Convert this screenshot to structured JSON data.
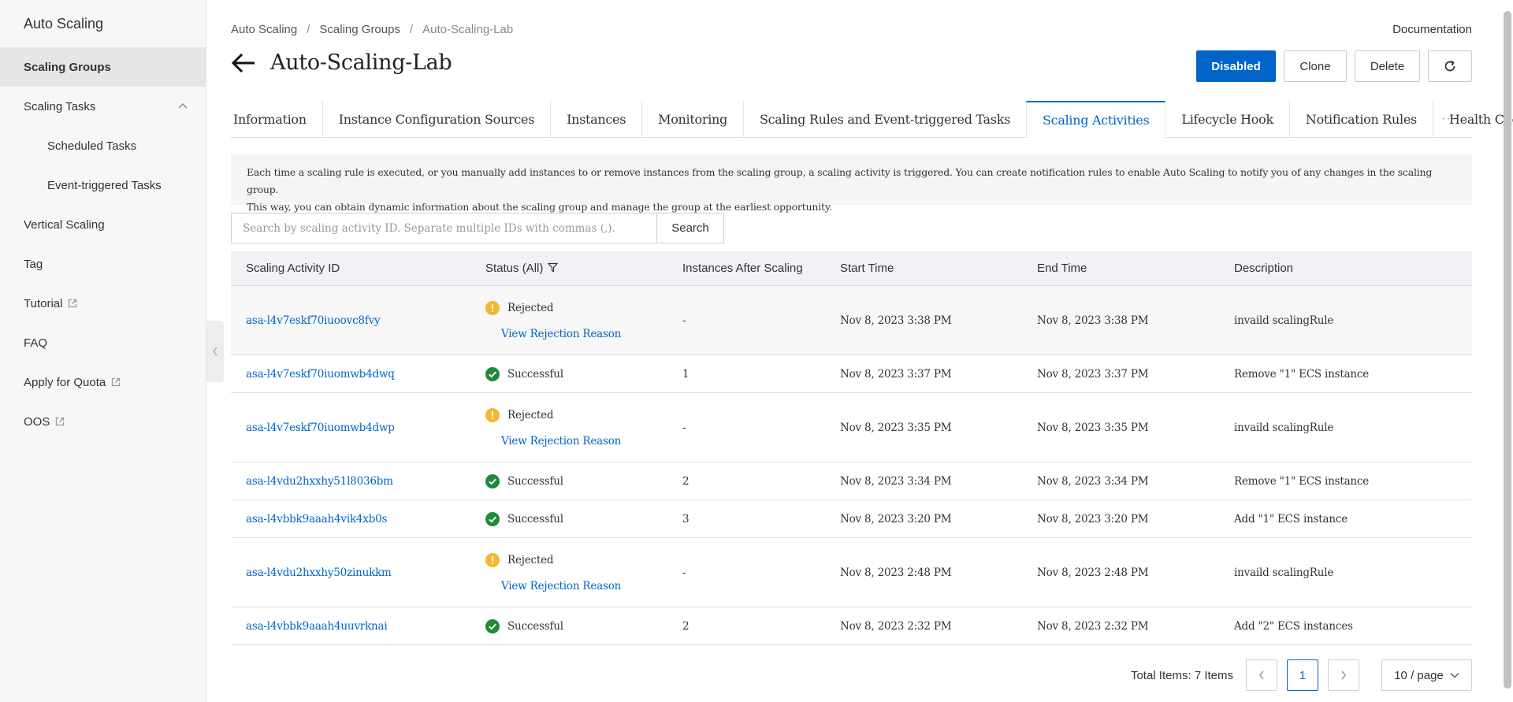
{
  "sidebar": {
    "title": "Auto Scaling",
    "items": [
      {
        "label": "Scaling Groups"
      },
      {
        "label": "Scaling Tasks"
      },
      {
        "label": "Scheduled Tasks"
      },
      {
        "label": "Event-triggered Tasks"
      },
      {
        "label": "Vertical Scaling"
      },
      {
        "label": "Tag"
      },
      {
        "label": "Tutorial"
      },
      {
        "label": "FAQ"
      },
      {
        "label": "Apply for Quota"
      },
      {
        "label": "OOS"
      }
    ]
  },
  "breadcrumb": [
    "Auto Scaling",
    "Scaling Groups",
    "Auto-Scaling-Lab"
  ],
  "breadcrumb_sep": "/",
  "documentation": "Documentation",
  "page_title": "Auto-Scaling-Lab",
  "actions": {
    "disabled": "Disabled",
    "clone": "Clone",
    "delete": "Delete"
  },
  "tabs": [
    "Information",
    "Instance Configuration Sources",
    "Instances",
    "Monitoring",
    "Scaling Rules and Event-triggered Tasks",
    "Scaling Activities",
    "Lifecycle Hook",
    "Notification Rules",
    "Health Check"
  ],
  "active_tab": "Scaling Activities",
  "tabs_more": "···",
  "notice": {
    "line1": "Each time a scaling rule is executed, or you manually add instances to or remove instances from the scaling group, a scaling activity is triggered. You can create notification rules to enable Auto Scaling to notify you of any changes in the scaling group.",
    "line2": "This way, you can obtain dynamic information about the scaling group and manage the group at the earliest opportunity."
  },
  "search": {
    "placeholder": "Search by scaling activity ID. Separate multiple IDs with commas (,).",
    "button": "Search"
  },
  "table": {
    "headers": [
      "Scaling Activity ID",
      "Status (All)",
      "Instances After Scaling",
      "Start Time",
      "End Time",
      "Description"
    ],
    "rows": [
      {
        "id": "asa-l4v7eskf70iuoovc8fvy",
        "status": "Rejected",
        "reason": "View Rejection Reason",
        "instances": "-",
        "start": "Nov 8, 2023 3:38 PM",
        "end": "Nov 8, 2023 3:38 PM",
        "description": "invaild scalingRule"
      },
      {
        "id": "asa-l4v7eskf70iuomwb4dwq",
        "status": "Successful",
        "instances": "1",
        "start": "Nov 8, 2023 3:37 PM",
        "end": "Nov 8, 2023 3:37 PM",
        "description": "Remove \"1\" ECS instance"
      },
      {
        "id": "asa-l4v7eskf70iuomwb4dwp",
        "status": "Rejected",
        "reason": "View Rejection Reason",
        "instances": "-",
        "start": "Nov 8, 2023 3:35 PM",
        "end": "Nov 8, 2023 3:35 PM",
        "description": "invaild scalingRule"
      },
      {
        "id": "asa-l4vdu2hxxhy51l8036bm",
        "status": "Successful",
        "instances": "2",
        "start": "Nov 8, 2023 3:34 PM",
        "end": "Nov 8, 2023 3:34 PM",
        "description": "Remove \"1\" ECS instance"
      },
      {
        "id": "asa-l4vbbk9aaah4vik4xb0s",
        "status": "Successful",
        "instances": "3",
        "start": "Nov 8, 2023 3:20 PM",
        "end": "Nov 8, 2023 3:20 PM",
        "description": "Add \"1\" ECS instance"
      },
      {
        "id": "asa-l4vdu2hxxhy50zinukkm",
        "status": "Rejected",
        "reason": "View Rejection Reason",
        "instances": "-",
        "start": "Nov 8, 2023 2:48 PM",
        "end": "Nov 8, 2023 2:48 PM",
        "description": "invaild scalingRule"
      },
      {
        "id": "asa-l4vbbk9aaah4uuvrknai",
        "status": "Successful",
        "instances": "2",
        "start": "Nov 8, 2023 2:32 PM",
        "end": "Nov 8, 2023 2:32 PM",
        "description": "Add \"2\" ECS instances"
      }
    ]
  },
  "pagination": {
    "total": "Total Items: 7 Items",
    "page": "1",
    "page_size": "10 / page"
  },
  "colors": {
    "accent": "#0064c8",
    "success": "#1f8a3b",
    "warning": "#f5b731"
  }
}
